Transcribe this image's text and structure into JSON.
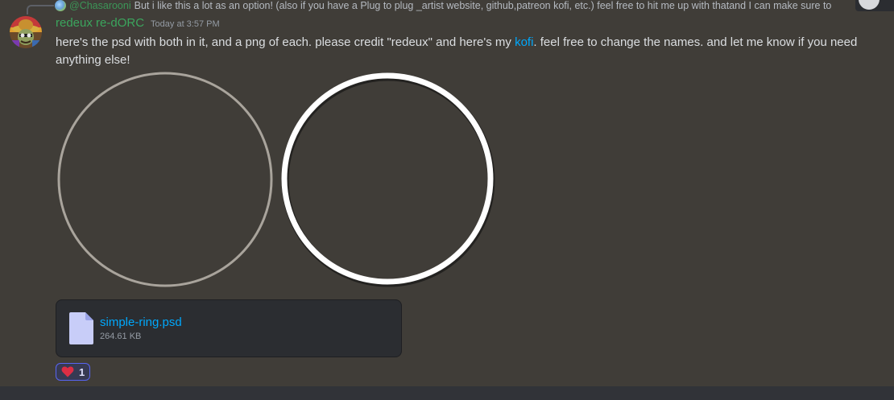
{
  "reply": {
    "author": "@Chasarooni",
    "text": "But i like this a lot as an option! (also if you have a Plug to plug _artist website, github,patreon kofi, etc.) feel free to hit me up with thatand I can make sure to"
  },
  "message": {
    "username": "redeux re-dORC",
    "timestamp": "Today at 3:57 PM",
    "text_before_link": "here's the psd with both in it, and a  png of each. please credit \"redeux\" and here's my ",
    "link_text": "kofi",
    "text_after_link": ". feel free to change the names. and let me know if you need anything else!"
  },
  "attachment": {
    "file_name": "simple-ring.psd",
    "file_size": "264.61 KB",
    "icon": "file-icon"
  },
  "reaction": {
    "emoji": "heart-icon",
    "count": "1"
  },
  "colors": {
    "username": "#3ba55d",
    "link": "#00a8fc",
    "background": "#403d38",
    "reaction_accent": "#5865f2"
  }
}
